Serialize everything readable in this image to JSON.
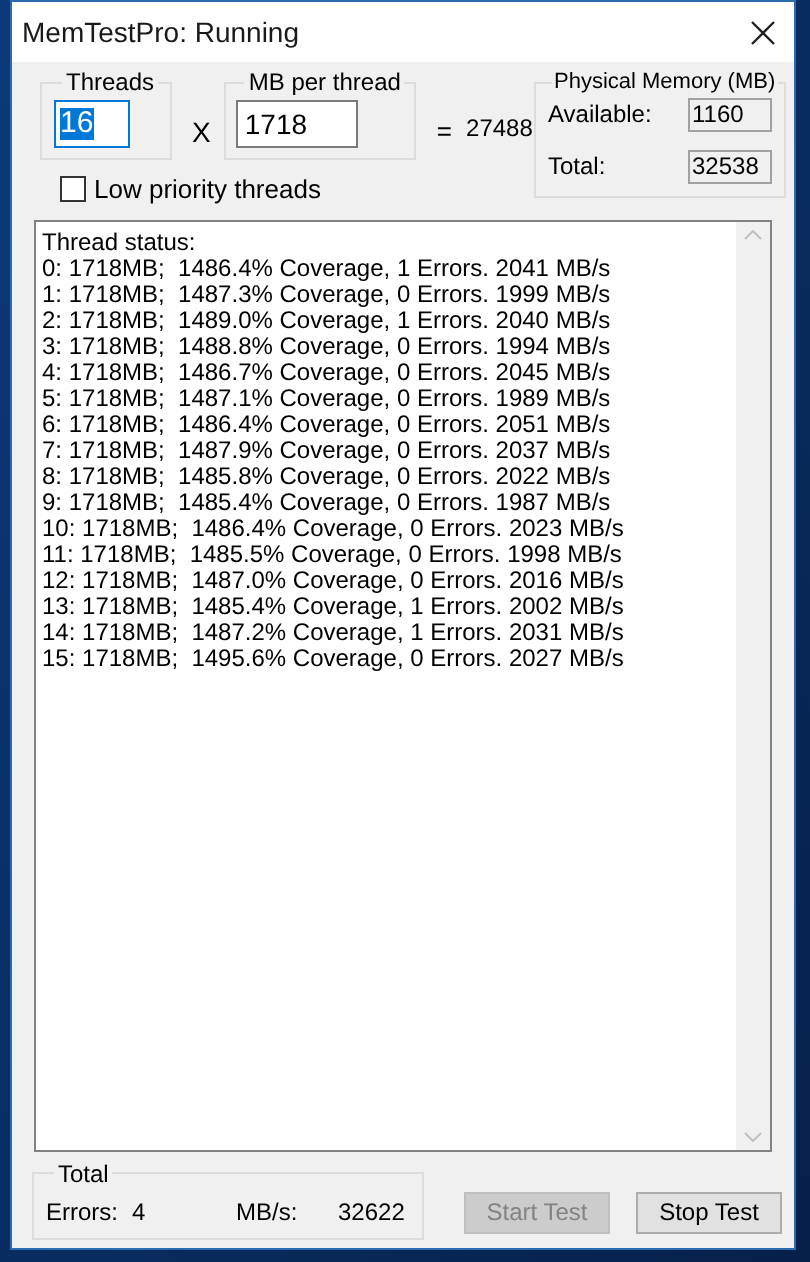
{
  "window": {
    "title": "MemTestPro: Running"
  },
  "threads": {
    "label": "Threads",
    "value": "16",
    "text_selected": true
  },
  "multiply_sign": "X",
  "mb_per_thread": {
    "label": "MB per thread",
    "value": "1718"
  },
  "equals_sign": "=",
  "total_mb": "27488",
  "physical_memory": {
    "label": "Physical Memory (MB)",
    "available_label": "Available:",
    "available": "1160",
    "total_label": "Total:",
    "total": "32538"
  },
  "low_priority": {
    "label": "Low priority threads",
    "checked": false
  },
  "status": {
    "header": "Thread status:",
    "lines": [
      "0: 1718MB;  1486.4% Coverage, 1 Errors. 2041 MB/s",
      "1: 1718MB;  1487.3% Coverage, 0 Errors. 1999 MB/s",
      "2: 1718MB;  1489.0% Coverage, 1 Errors. 2040 MB/s",
      "3: 1718MB;  1488.8% Coverage, 0 Errors. 1994 MB/s",
      "4: 1718MB;  1486.7% Coverage, 0 Errors. 2045 MB/s",
      "5: 1718MB;  1487.1% Coverage, 0 Errors. 1989 MB/s",
      "6: 1718MB;  1486.4% Coverage, 0 Errors. 2051 MB/s",
      "7: 1718MB;  1487.9% Coverage, 0 Errors. 2037 MB/s",
      "8: 1718MB;  1485.8% Coverage, 0 Errors. 2022 MB/s",
      "9: 1718MB;  1485.4% Coverage, 0 Errors. 1987 MB/s",
      "10: 1718MB;  1486.4% Coverage, 0 Errors. 2023 MB/s",
      "11: 1718MB;  1485.5% Coverage, 0 Errors. 1998 MB/s",
      "12: 1718MB;  1487.0% Coverage, 0 Errors. 2016 MB/s",
      "13: 1718MB;  1485.4% Coverage, 1 Errors. 2002 MB/s",
      "14: 1718MB;  1487.2% Coverage, 1 Errors. 2031 MB/s",
      "15: 1718MB;  1495.6% Coverage, 0 Errors. 2027 MB/s"
    ]
  },
  "totals": {
    "label": "Total",
    "errors_label": "Errors:",
    "errors": "4",
    "rate_label": "MB/s:",
    "rate": "32622"
  },
  "buttons": [
    {
      "label": "Start Test",
      "disabled": true
    },
    {
      "label": "Stop Test",
      "disabled": false
    }
  ]
}
